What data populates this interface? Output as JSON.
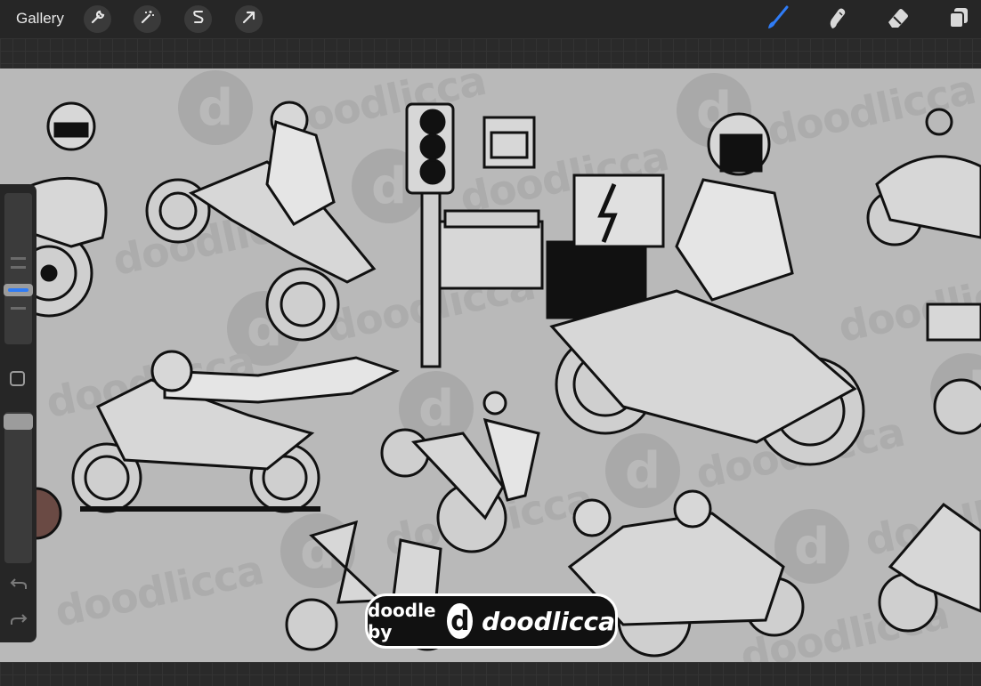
{
  "topbar": {
    "gallery_label": "Gallery",
    "left_tools": [
      {
        "name": "wrench-icon",
        "semantic": "actions"
      },
      {
        "name": "magic-wand-icon",
        "semantic": "adjustments"
      },
      {
        "name": "selection-s-icon",
        "semantic": "selection"
      },
      {
        "name": "arrow-cursor-icon",
        "semantic": "transform"
      }
    ],
    "right_tools": [
      {
        "name": "brush-icon",
        "semantic": "brush",
        "active": true
      },
      {
        "name": "smudge-icon",
        "semantic": "smudge",
        "active": false
      },
      {
        "name": "eraser-icon",
        "semantic": "eraser",
        "active": false
      },
      {
        "name": "layers-icon",
        "semantic": "layers",
        "active": false
      }
    ]
  },
  "sidebar": {
    "brush_size_level": 0.45,
    "opacity_level": 0.0,
    "undo_icon": "undo-icon",
    "redo_icon": "redo-icon",
    "modify_icon": "square-modify-icon"
  },
  "canvas": {
    "watermark_word": "doodlicca",
    "watermark_letter": "d",
    "badge": {
      "prefix": "doodle by",
      "logo_letter": "d",
      "brand": "doodlicca"
    }
  },
  "colors": {
    "toolbar_bg": "#262626",
    "canvas_bg": "#b9b9b9",
    "accent_blue": "#2f7cf6",
    "watermark": "#a9a9a9"
  }
}
